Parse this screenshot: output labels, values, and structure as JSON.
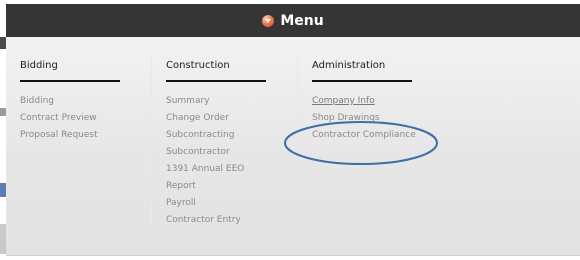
{
  "header": {
    "title": "Menu",
    "icon": "menu-dropdown-icon",
    "bg_color": "#353535",
    "icon_color": "#e8643a"
  },
  "columns": [
    {
      "title": "Bidding",
      "items": [
        "Bidding",
        "Contract Preview",
        "Proposal Request"
      ]
    },
    {
      "title": "Construction",
      "items": [
        "Summary",
        "Change Order",
        "Subcontracting",
        "Subcontractor",
        "1391 Annual EEO",
        "Report",
        "Payroll",
        "Contractor Entry"
      ]
    },
    {
      "title": "Administration",
      "items": [
        "Company Info",
        "Shop Drawings",
        "Contractor Compliance"
      ]
    }
  ],
  "annotation": {
    "type": "ellipse-highlight",
    "color": "#3f6ea8"
  }
}
